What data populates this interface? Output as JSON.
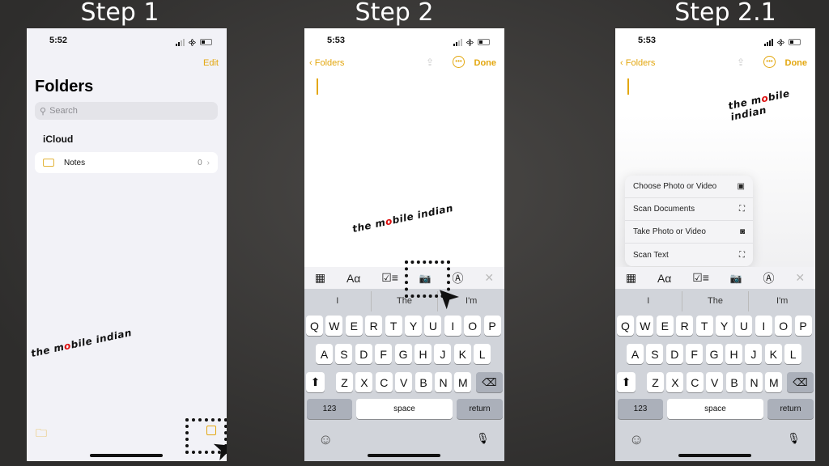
{
  "steps": [
    "Step 1",
    "Step 2",
    "Step 2.1"
  ],
  "watermark": "the mobile indian",
  "accent": "#e3a70f",
  "phone1": {
    "time": "5:52",
    "edit": "Edit",
    "title": "Folders",
    "search_placeholder": "Search",
    "section": "iCloud",
    "folder": {
      "name": "Notes",
      "count": "0"
    }
  },
  "phone2": {
    "time": "5:53",
    "back": "Folders",
    "done": "Done"
  },
  "phone3": {
    "time": "5:53",
    "back": "Folders",
    "done": "Done",
    "menu": [
      {
        "label": "Choose Photo or Video",
        "icon": "photo-library-icon"
      },
      {
        "label": "Scan Documents",
        "icon": "scan-document-icon"
      },
      {
        "label": "Take Photo or Video",
        "icon": "camera-icon"
      },
      {
        "label": "Scan Text",
        "icon": "scan-text-icon"
      }
    ]
  },
  "keyboard": {
    "toolbar": [
      {
        "name": "table-icon",
        "glyph": "▦"
      },
      {
        "name": "format-text-icon",
        "glyph": "Aα"
      },
      {
        "name": "checklist-icon",
        "glyph": "☑≡"
      },
      {
        "name": "camera-icon",
        "glyph": "📷"
      },
      {
        "name": "markup-icon",
        "glyph": "Ⓐ"
      },
      {
        "name": "close-icon",
        "glyph": "✕"
      }
    ],
    "predictions": [
      "I",
      "The",
      "I'm"
    ],
    "rows": [
      [
        "Q",
        "W",
        "E",
        "R",
        "T",
        "Y",
        "U",
        "I",
        "O",
        "P"
      ],
      [
        "A",
        "S",
        "D",
        "F",
        "G",
        "H",
        "J",
        "K",
        "L"
      ],
      [
        "Z",
        "X",
        "C",
        "V",
        "B",
        "N",
        "M"
      ]
    ],
    "numbers": "123",
    "space": "space",
    "return": "return",
    "shift": "⬆",
    "delete": "⌫",
    "emoji": "☺",
    "mic": "🎙"
  }
}
